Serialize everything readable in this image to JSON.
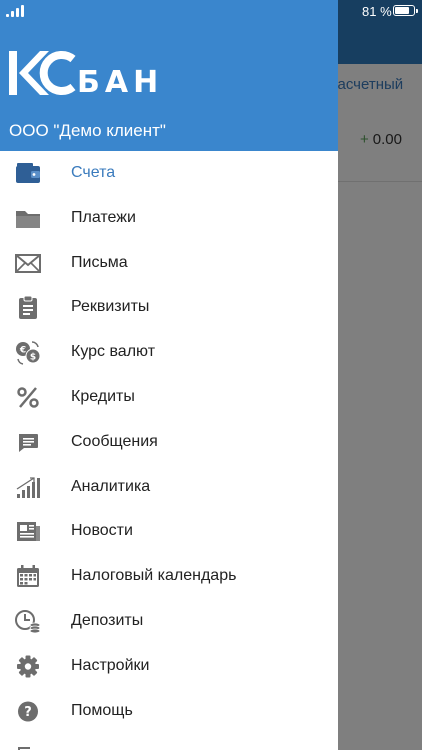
{
  "status_bar": {
    "battery_text": "81 %",
    "battery_level": 0.81
  },
  "background_screen": {
    "account_type": "Расчетный",
    "balance_sign": "+",
    "balance": "0.00"
  },
  "drawer": {
    "logo_letters": "КС",
    "logo_text": "БАНК",
    "client_name": "ООО \"Демо клиент\"",
    "active_item": "accounts",
    "items": [
      {
        "id": "accounts",
        "label": "Счета",
        "icon": "wallet-icon"
      },
      {
        "id": "payments",
        "label": "Платежи",
        "icon": "folder-icon"
      },
      {
        "id": "letters",
        "label": "Письма",
        "icon": "envelope-icon"
      },
      {
        "id": "requisites",
        "label": "Реквизиты",
        "icon": "clipboard-icon"
      },
      {
        "id": "rates",
        "label": "Курс валют",
        "icon": "currency-exchange-icon"
      },
      {
        "id": "credits",
        "label": "Кредиты",
        "icon": "percent-icon"
      },
      {
        "id": "messages",
        "label": "Сообщения",
        "icon": "chat-icon"
      },
      {
        "id": "analytics",
        "label": "Аналитика",
        "icon": "bar-chart-icon"
      },
      {
        "id": "news",
        "label": "Новости",
        "icon": "newspaper-icon"
      },
      {
        "id": "tax-calendar",
        "label": "Налоговый календарь",
        "icon": "calendar-icon"
      },
      {
        "id": "deposits",
        "label": "Депозиты",
        "icon": "clock-coins-icon"
      },
      {
        "id": "settings",
        "label": "Настройки",
        "icon": "gear-icon"
      },
      {
        "id": "help",
        "label": "Помощь",
        "icon": "help-icon"
      }
    ]
  },
  "colors": {
    "header_blue": "#3a86cd",
    "accent": "#3a7bbd",
    "icon_gray": "#6d6d6d"
  }
}
